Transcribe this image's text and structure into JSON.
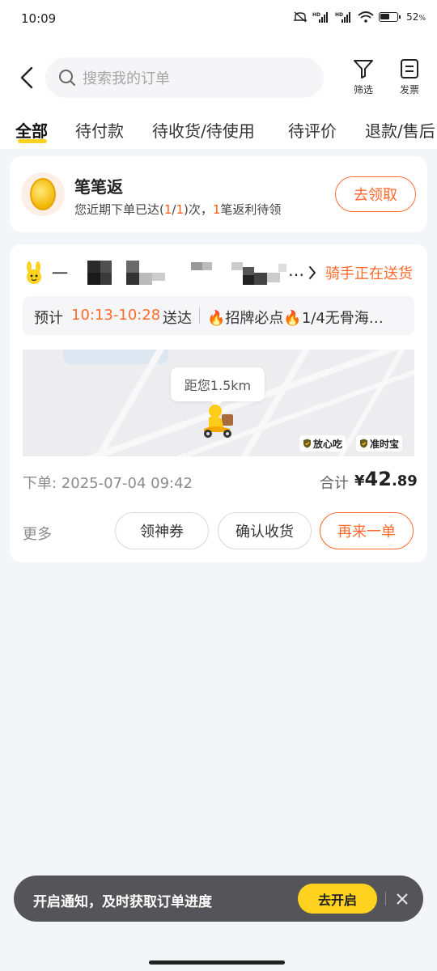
{
  "status_bar": {
    "time": "10:09",
    "battery": "52",
    "battery_unit": "%",
    "signal_label": "HD"
  },
  "header": {
    "search_placeholder": "搜索我的订单",
    "filter_label": "筛选",
    "invoice_label": "发票"
  },
  "tabs": [
    "全部",
    "待付款",
    "待收货/待使用",
    "待评价",
    "退款/售后"
  ],
  "active_tab": 0,
  "bibi_card": {
    "title": "笔笔返",
    "desc_prefix": "您近期下单已达(",
    "desc_count": "1",
    "desc_slash": "/",
    "desc_total": "1",
    "desc_mid": ")次，",
    "desc_pending": "1",
    "desc_suffix": "笔返利待领",
    "claim_button": "去领取"
  },
  "order": {
    "shop_prefix": "一",
    "shop_suffix": "…",
    "status": "骑手正在送货",
    "eta_prefix": "预计",
    "eta_time": "10:13-10:28",
    "eta_suffix": "送达",
    "items": "🔥招牌必点🔥1/4无骨海…",
    "distance": "距您1.5km",
    "badge_safe": "放心吃",
    "badge_ontime": "准时宝",
    "order_time": "下单: 2025-07-04 09:42",
    "total_label": "合计",
    "currency": "¥",
    "total_int": "42",
    "total_dec": ".89",
    "more": "更多",
    "btn_coupon": "领神券",
    "btn_confirm": "确认收货",
    "btn_reorder": "再来一单"
  },
  "notification": {
    "text": "开启通知，及时获取订单进度",
    "button": "去开启"
  },
  "colors": {
    "accent": "#ffd21f",
    "orange": "#ff6a2c",
    "bg": "#f4f5f9"
  }
}
